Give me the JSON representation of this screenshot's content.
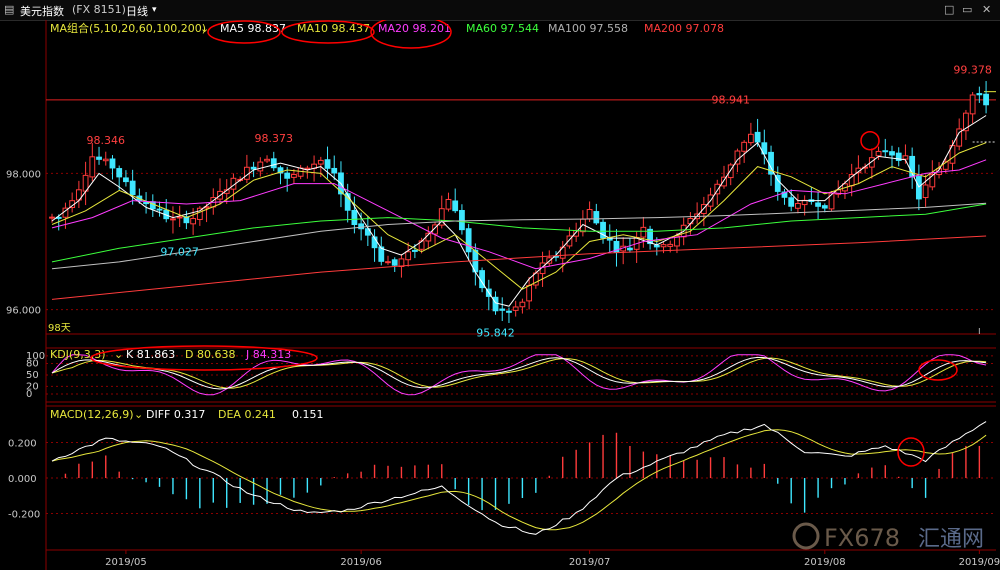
{
  "window": {
    "title": "美元指数",
    "code": "(FX 8151)",
    "period": "日线",
    "period_arrow": "▾",
    "buttons": [
      "□",
      "▭",
      "✕"
    ]
  },
  "colors": {
    "up": "#ff3b3b",
    "down": "#3fe7ff",
    "grid": "#8b0000",
    "ma5": "#ffffff",
    "ma10": "#e6e63c",
    "ma20": "#ff3cff",
    "ma60": "#3cff3c",
    "ma100": "#c0c0c0",
    "ma200": "#ff3b3b",
    "k": "#ffffff",
    "d": "#e6e63c",
    "j": "#ff3cff",
    "diff": "#ffffff",
    "dea": "#e6e63c",
    "annotation": "#ff0000"
  },
  "watermark": {
    "text": "FX678",
    "cn": "汇通网"
  },
  "chart_data": [
    {
      "type": "candlestick",
      "header": {
        "group": "MA组合(5,10,20,60,100,200)",
        "ma": [
          {
            "label": "MA5",
            "value": "98.837"
          },
          {
            "label": "MA10",
            "value": "98.437"
          },
          {
            "label": "MA20",
            "value": "98.201"
          },
          {
            "label": "MA60",
            "value": "97.544"
          },
          {
            "label": "MA100",
            "value": "97.558"
          },
          {
            "label": "MA200",
            "value": "97.078"
          }
        ]
      },
      "y_ticks": [
        "98.000",
        "96.000"
      ],
      "y_tick_values": [
        98.0,
        96.0
      ],
      "ylim": [
        95.7,
        99.9
      ],
      "level_line": 99.08,
      "dotted_level": 98.46,
      "days_label": "98天",
      "price_labels": [
        {
          "text": "98.346",
          "value": 98.346
        },
        {
          "text": "98.373",
          "value": 98.373
        },
        {
          "text": "98.941",
          "value": 98.941
        },
        {
          "text": "99.378",
          "value": 99.378
        },
        {
          "text": "97.027",
          "value": 97.027
        },
        {
          "text": "95.842",
          "value": 95.842
        }
      ],
      "anchors": [
        [
          1,
          97.35
        ],
        [
          4,
          97.8
        ],
        [
          6,
          98.25
        ],
        [
          9,
          98.1
        ],
        [
          12,
          97.7
        ],
        [
          15,
          97.5
        ],
        [
          18,
          97.3
        ],
        [
          21,
          97.35
        ],
        [
          24,
          97.6
        ],
        [
          26,
          97.8
        ],
        [
          29,
          98.05
        ],
        [
          32,
          98.25
        ],
        [
          35,
          97.9
        ],
        [
          38,
          98.1
        ],
        [
          40,
          98.2
        ],
        [
          42,
          97.95
        ],
        [
          44,
          97.4
        ],
        [
          47,
          97.1
        ],
        [
          49,
          96.75
        ],
        [
          51,
          96.65
        ],
        [
          53,
          96.8
        ],
        [
          55,
          97.0
        ],
        [
          57,
          97.3
        ],
        [
          59,
          97.65
        ],
        [
          61,
          97.2
        ],
        [
          63,
          96.5
        ],
        [
          66,
          96.0
        ],
        [
          68,
          95.95
        ],
        [
          70,
          96.1
        ],
        [
          72,
          96.55
        ],
        [
          75,
          96.8
        ],
        [
          78,
          97.2
        ],
        [
          80,
          97.45
        ],
        [
          82,
          97.1
        ],
        [
          84,
          96.9
        ],
        [
          86,
          96.9
        ],
        [
          88,
          97.25
        ],
        [
          89,
          97.0
        ],
        [
          91,
          96.9
        ],
        [
          94,
          97.2
        ],
        [
          97,
          97.55
        ],
        [
          100,
          97.95
        ],
        [
          102,
          98.35
        ],
        [
          104,
          98.55
        ],
        [
          106,
          98.3
        ],
        [
          108,
          97.7
        ],
        [
          111,
          97.5
        ],
        [
          113,
          97.6
        ],
        [
          115,
          97.55
        ],
        [
          118,
          97.85
        ],
        [
          120,
          98.1
        ],
        [
          122,
          98.2
        ],
        [
          124,
          98.35
        ],
        [
          126,
          98.25
        ],
        [
          127,
          98.2
        ],
        [
          129,
          97.65
        ],
        [
          131,
          97.95
        ],
        [
          133,
          98.2
        ],
        [
          135,
          98.7
        ],
        [
          137,
          99.15
        ],
        [
          139,
          99.05
        ]
      ],
      "ma_keys": [
        "ma5",
        "ma10",
        "ma20",
        "ma60",
        "ma100",
        "ma200"
      ],
      "ma_paths": {
        "ma5": [
          [
            0,
            97.3
          ],
          [
            4,
            97.6
          ],
          [
            7,
            98.0
          ],
          [
            10,
            97.8
          ],
          [
            14,
            97.5
          ],
          [
            18,
            97.35
          ],
          [
            22,
            97.45
          ],
          [
            26,
            97.75
          ],
          [
            30,
            98.05
          ],
          [
            34,
            98.15
          ],
          [
            38,
            98.05
          ],
          [
            40,
            98.1
          ],
          [
            43,
            97.85
          ],
          [
            46,
            97.35
          ],
          [
            49,
            96.9
          ],
          [
            52,
            96.8
          ],
          [
            55,
            97.0
          ],
          [
            58,
            97.3
          ],
          [
            60,
            97.1
          ],
          [
            63,
            96.55
          ],
          [
            66,
            96.1
          ],
          [
            68,
            96.05
          ],
          [
            71,
            96.45
          ],
          [
            75,
            96.8
          ],
          [
            79,
            97.25
          ],
          [
            83,
            97.05
          ],
          [
            87,
            97.05
          ],
          [
            90,
            96.95
          ],
          [
            94,
            97.15
          ],
          [
            98,
            97.6
          ],
          [
            102,
            98.2
          ],
          [
            105,
            98.45
          ],
          [
            108,
            97.9
          ],
          [
            111,
            97.6
          ],
          [
            115,
            97.6
          ],
          [
            119,
            97.95
          ],
          [
            123,
            98.25
          ],
          [
            127,
            98.2
          ],
          [
            129,
            97.8
          ],
          [
            132,
            98.05
          ],
          [
            135,
            98.6
          ],
          [
            139,
            98.85
          ]
        ],
        "ma10": [
          [
            0,
            97.25
          ],
          [
            5,
            97.45
          ],
          [
            10,
            97.75
          ],
          [
            15,
            97.55
          ],
          [
            20,
            97.35
          ],
          [
            25,
            97.55
          ],
          [
            30,
            97.9
          ],
          [
            35,
            98.05
          ],
          [
            40,
            98.0
          ],
          [
            45,
            97.55
          ],
          [
            50,
            97.1
          ],
          [
            55,
            96.85
          ],
          [
            60,
            97.1
          ],
          [
            65,
            96.7
          ],
          [
            70,
            96.3
          ],
          [
            75,
            96.55
          ],
          [
            80,
            97.0
          ],
          [
            85,
            97.1
          ],
          [
            90,
            97.0
          ],
          [
            95,
            97.15
          ],
          [
            100,
            97.6
          ],
          [
            105,
            98.1
          ],
          [
            110,
            97.95
          ],
          [
            115,
            97.7
          ],
          [
            120,
            97.85
          ],
          [
            125,
            98.1
          ],
          [
            130,
            97.95
          ],
          [
            135,
            98.3
          ],
          [
            139,
            98.45
          ]
        ],
        "ma20": [
          [
            0,
            97.2
          ],
          [
            6,
            97.35
          ],
          [
            12,
            97.6
          ],
          [
            20,
            97.55
          ],
          [
            28,
            97.6
          ],
          [
            36,
            97.85
          ],
          [
            42,
            97.85
          ],
          [
            50,
            97.45
          ],
          [
            58,
            97.05
          ],
          [
            65,
            96.85
          ],
          [
            72,
            96.6
          ],
          [
            80,
            96.75
          ],
          [
            88,
            97.0
          ],
          [
            96,
            97.1
          ],
          [
            104,
            97.55
          ],
          [
            110,
            97.75
          ],
          [
            118,
            97.7
          ],
          [
            124,
            97.85
          ],
          [
            130,
            98.0
          ],
          [
            135,
            98.05
          ],
          [
            139,
            98.2
          ]
        ],
        "ma60": [
          [
            0,
            96.7
          ],
          [
            10,
            96.9
          ],
          [
            20,
            97.05
          ],
          [
            30,
            97.2
          ],
          [
            40,
            97.3
          ],
          [
            50,
            97.35
          ],
          [
            60,
            97.3
          ],
          [
            70,
            97.2
          ],
          [
            80,
            97.15
          ],
          [
            90,
            97.15
          ],
          [
            100,
            97.2
          ],
          [
            110,
            97.3
          ],
          [
            120,
            97.35
          ],
          [
            130,
            97.4
          ],
          [
            139,
            97.55
          ]
        ],
        "ma100": [
          [
            0,
            96.6
          ],
          [
            10,
            96.7
          ],
          [
            20,
            96.85
          ],
          [
            30,
            97.0
          ],
          [
            40,
            97.15
          ],
          [
            50,
            97.25
          ],
          [
            60,
            97.3
          ],
          [
            70,
            97.32
          ],
          [
            80,
            97.33
          ],
          [
            90,
            97.35
          ],
          [
            100,
            97.38
          ],
          [
            110,
            97.42
          ],
          [
            120,
            97.46
          ],
          [
            130,
            97.5
          ],
          [
            139,
            97.56
          ]
        ],
        "ma200": [
          [
            0,
            96.15
          ],
          [
            20,
            96.35
          ],
          [
            40,
            96.55
          ],
          [
            60,
            96.7
          ],
          [
            80,
            96.82
          ],
          [
            100,
            96.9
          ],
          [
            120,
            96.98
          ],
          [
            139,
            97.08
          ]
        ]
      }
    },
    {
      "type": "line",
      "title": "KDJ(9,3,3)",
      "series": [
        {
          "name": "K",
          "value": "81.863"
        },
        {
          "name": "D",
          "value": "80.638"
        },
        {
          "name": "J",
          "value": "84.313"
        }
      ],
      "y_ticks": [
        "100",
        "80",
        "50",
        "20",
        "0"
      ],
      "y_tick_values": [
        100,
        80,
        50,
        20,
        0
      ],
      "ylim": [
        0,
        105
      ]
    },
    {
      "type": "bar",
      "title": "MACD(12,26,9)",
      "series": [
        {
          "name": "DIFF",
          "value": "0.317"
        },
        {
          "name": "DEA",
          "value": "0.241"
        },
        {
          "name": "",
          "value": "0.151"
        }
      ],
      "y_ticks": [
        "0.200",
        "0.000",
        "-0.200"
      ],
      "y_tick_values": [
        0.2,
        0.0,
        -0.2
      ],
      "ylim": [
        -0.36,
        0.36
      ]
    }
  ],
  "x_axis": {
    "ticks": [
      {
        "label": "2019/05",
        "index": 11
      },
      {
        "label": "2019/06",
        "index": 46
      },
      {
        "label": "2019/07",
        "index": 80
      },
      {
        "label": "2019/08",
        "index": 115
      },
      {
        "label": "2019/09",
        "index": 138
      }
    ]
  }
}
